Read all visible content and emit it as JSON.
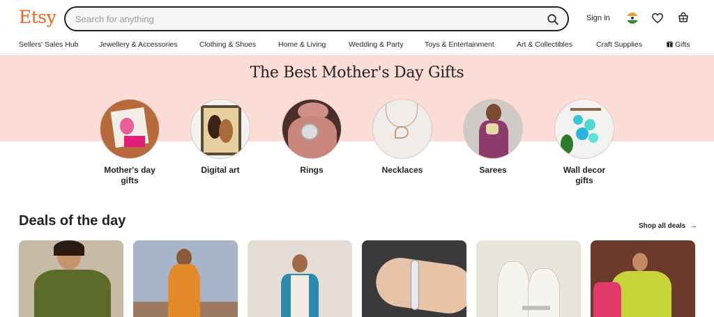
{
  "header": {
    "logo": "Etsy",
    "search_placeholder": "Search for anything",
    "sign_in": "Sign in"
  },
  "nav": {
    "items": [
      "Sellers' Sales Hub",
      "Jewellery & Accessories",
      "Clothing & Shoes",
      "Home & Living",
      "Wedding & Party",
      "Toys & Entertainment",
      "Art & Collectibles",
      "Craft Supplies",
      "Gifts"
    ]
  },
  "hero": {
    "title": "The Best Mother's Day Gifts",
    "categories": [
      {
        "line1": "Mother's day",
        "line2": "gifts"
      },
      {
        "line1": "Digital art",
        "line2": ""
      },
      {
        "line1": "Rings",
        "line2": ""
      },
      {
        "line1": "Necklaces",
        "line2": ""
      },
      {
        "line1": "Sarees",
        "line2": ""
      },
      {
        "line1": "Wall decor",
        "line2": "gifts"
      }
    ]
  },
  "deals": {
    "title": "Deals of the day",
    "shop_all": "Shop all deals"
  },
  "colors": {
    "brand": "#f1641e",
    "hero_band": "#fcdcd6",
    "text": "#222222"
  }
}
